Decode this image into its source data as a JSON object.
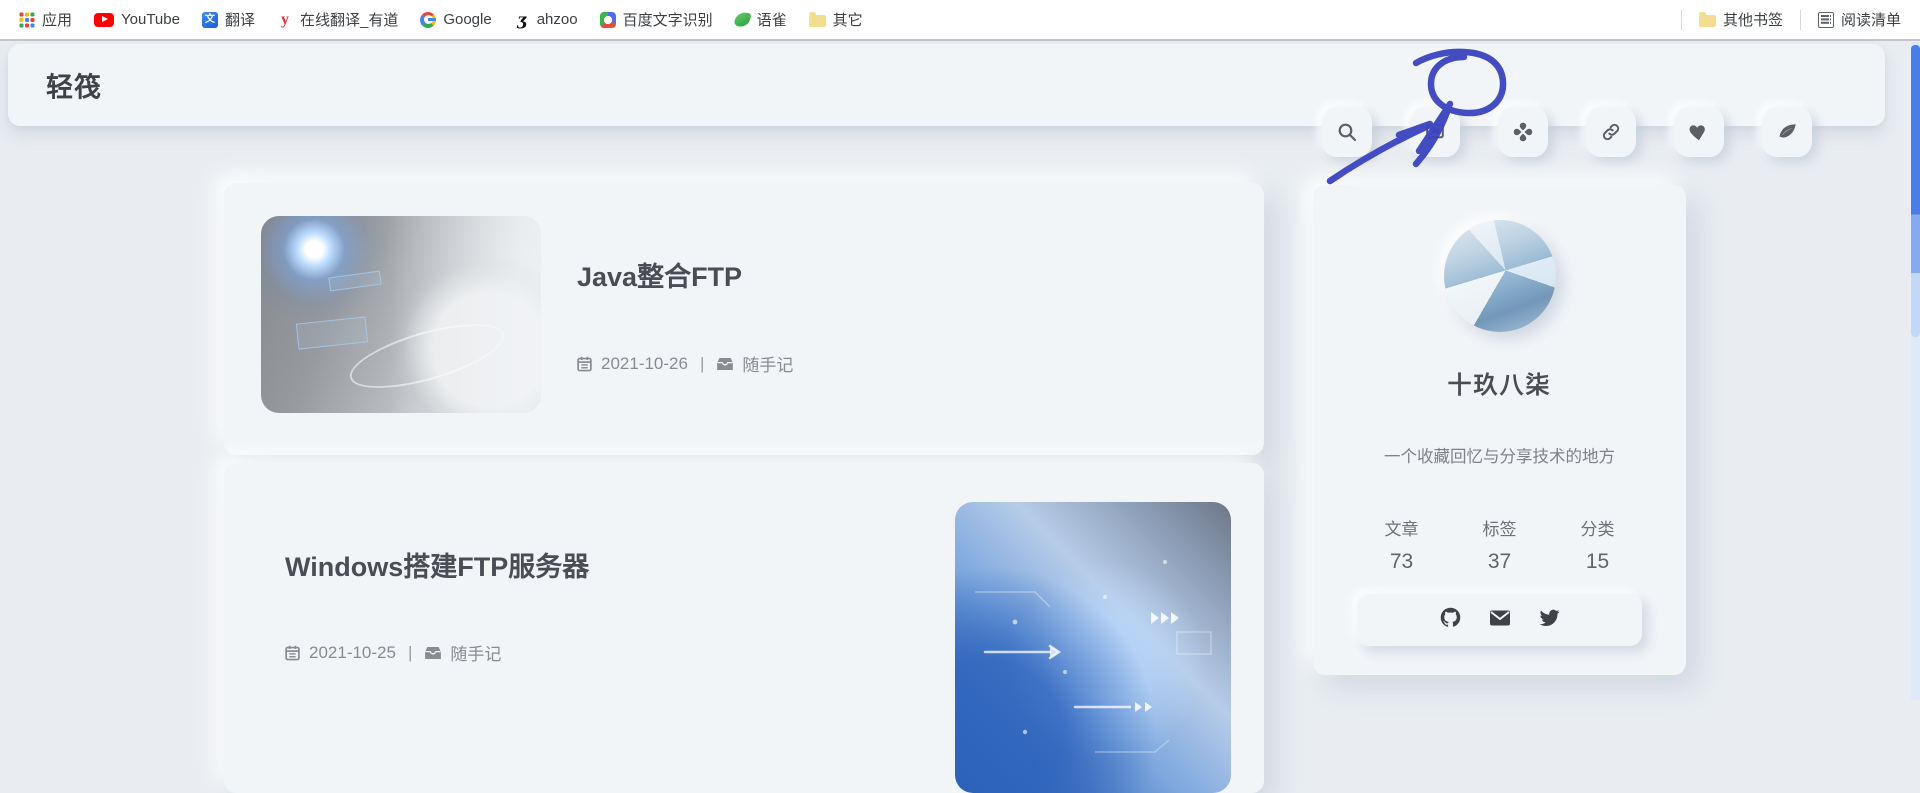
{
  "bookmarks": {
    "items": [
      {
        "label": "应用",
        "icon": "apps-grid-icon"
      },
      {
        "label": "YouTube",
        "icon": "youtube-icon"
      },
      {
        "label": "翻译",
        "icon": "translate-icon"
      },
      {
        "label": "在线翻译_有道",
        "icon": "youdao-icon"
      },
      {
        "label": "Google",
        "icon": "google-icon"
      },
      {
        "label": "ahzoo",
        "icon": "ahzoo-icon"
      },
      {
        "label": "百度文字识别",
        "icon": "baidu-ocr-icon"
      },
      {
        "label": "语雀",
        "icon": "yuque-icon"
      },
      {
        "label": "其它",
        "icon": "folder-icon"
      }
    ],
    "other_bookmarks": "其他书签",
    "reading_list": "阅读清单"
  },
  "header": {
    "logo": "轻筏",
    "buttons": [
      "search",
      "comment",
      "clover",
      "link",
      "heart",
      "leaf"
    ]
  },
  "posts": [
    {
      "title": "Java整合FTP",
      "date": "2021-10-26",
      "separator": "|",
      "category": "随手记"
    },
    {
      "title": "Windows搭建FTP服务器",
      "date": "2021-10-25",
      "separator": "|",
      "category": "随手记"
    }
  ],
  "profile": {
    "name": "十玖八柒",
    "bio": "一个收藏回忆与分享技术的地方",
    "stats": [
      {
        "label": "文章",
        "value": "73"
      },
      {
        "label": "标签",
        "value": "37"
      },
      {
        "label": "分类",
        "value": "15"
      }
    ],
    "social": [
      "github",
      "email",
      "twitter"
    ]
  },
  "annotation": {
    "color": "#3b44c0"
  }
}
